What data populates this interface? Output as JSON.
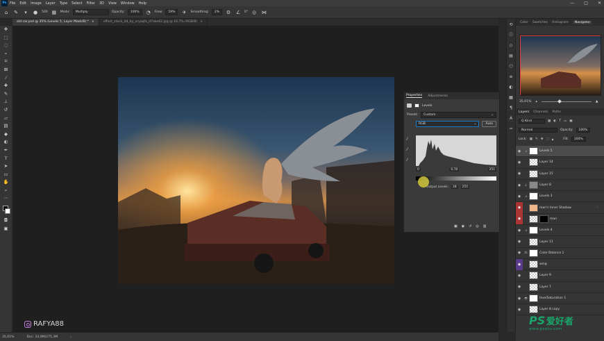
{
  "menu": [
    "File",
    "Edit",
    "Image",
    "Layer",
    "Type",
    "Select",
    "Filter",
    "3D",
    "View",
    "Window",
    "Help"
  ],
  "window_controls": [
    "—",
    "□",
    "✕"
  ],
  "options": {
    "brush_size": "500",
    "mode_label": "Mode:",
    "mode_value": "Multiply",
    "opacity_label": "Opacity:",
    "opacity_value": "100%",
    "flow_label": "Flow:",
    "flow_value": "59%",
    "smoothing_label": "Smoothing:",
    "smoothing_value": "2%",
    "angle_value": "0°"
  },
  "doc_tabs": [
    {
      "label": "old car.psd @ 35% (Levels 5, Layer Mask/8) *"
    },
    {
      "label": "effect_stock_04_by_cryoqfx_d7ake62.jpg @ 16,7% (RGB/8)"
    }
  ],
  "status": {
    "zoom": "35,01%",
    "doc": "Doc: 33,9M/275,3M"
  },
  "watermark": {
    "handle": "RAFYA88"
  },
  "properties": {
    "tabs": [
      "Properties",
      "Adjustments"
    ],
    "title": "Levels",
    "preset_label": "Preset:",
    "preset_value": "Custom",
    "channel_value": "RGB",
    "auto_label": "Auto",
    "input_black": "0",
    "input_gamma": "0,78",
    "input_white": "251",
    "output_label": "Output Levels:",
    "output_black": "28",
    "output_white": "255"
  },
  "panels": {
    "top_tabs": [
      "Color",
      "Swatches",
      "Histogram",
      "Navigator"
    ],
    "nav_zoom": "35,01%",
    "layers_tabs": [
      "Layers",
      "Channels",
      "Paths"
    ],
    "kind_label": "Q Kind",
    "blend_value": "Normal",
    "opacity_label": "Opacity:",
    "opacity_value": "100%",
    "lock_label": "Lock:",
    "fill_label": "Fill:",
    "fill_value": "100%"
  },
  "layers": [
    {
      "name": "Levels 5"
    },
    {
      "name": "Layer 14"
    },
    {
      "name": "Layer 15"
    },
    {
      "name": "Layer 8"
    },
    {
      "name": "Levels 3"
    },
    {
      "name": "man's Inner Shadow"
    },
    {
      "name": "man"
    },
    {
      "name": "Levels 4"
    },
    {
      "name": "Layer 11"
    },
    {
      "name": "Color Balance 1"
    },
    {
      "name": "wing"
    },
    {
      "name": "Layer 9"
    },
    {
      "name": "Layer 7"
    },
    {
      "name": "Hue/Saturation 1"
    },
    {
      "name": "Layer 8 copy"
    }
  ],
  "site_watermark": {
    "logo": "PS",
    "cn": "爱好者",
    "url": "www.psahz.com"
  }
}
